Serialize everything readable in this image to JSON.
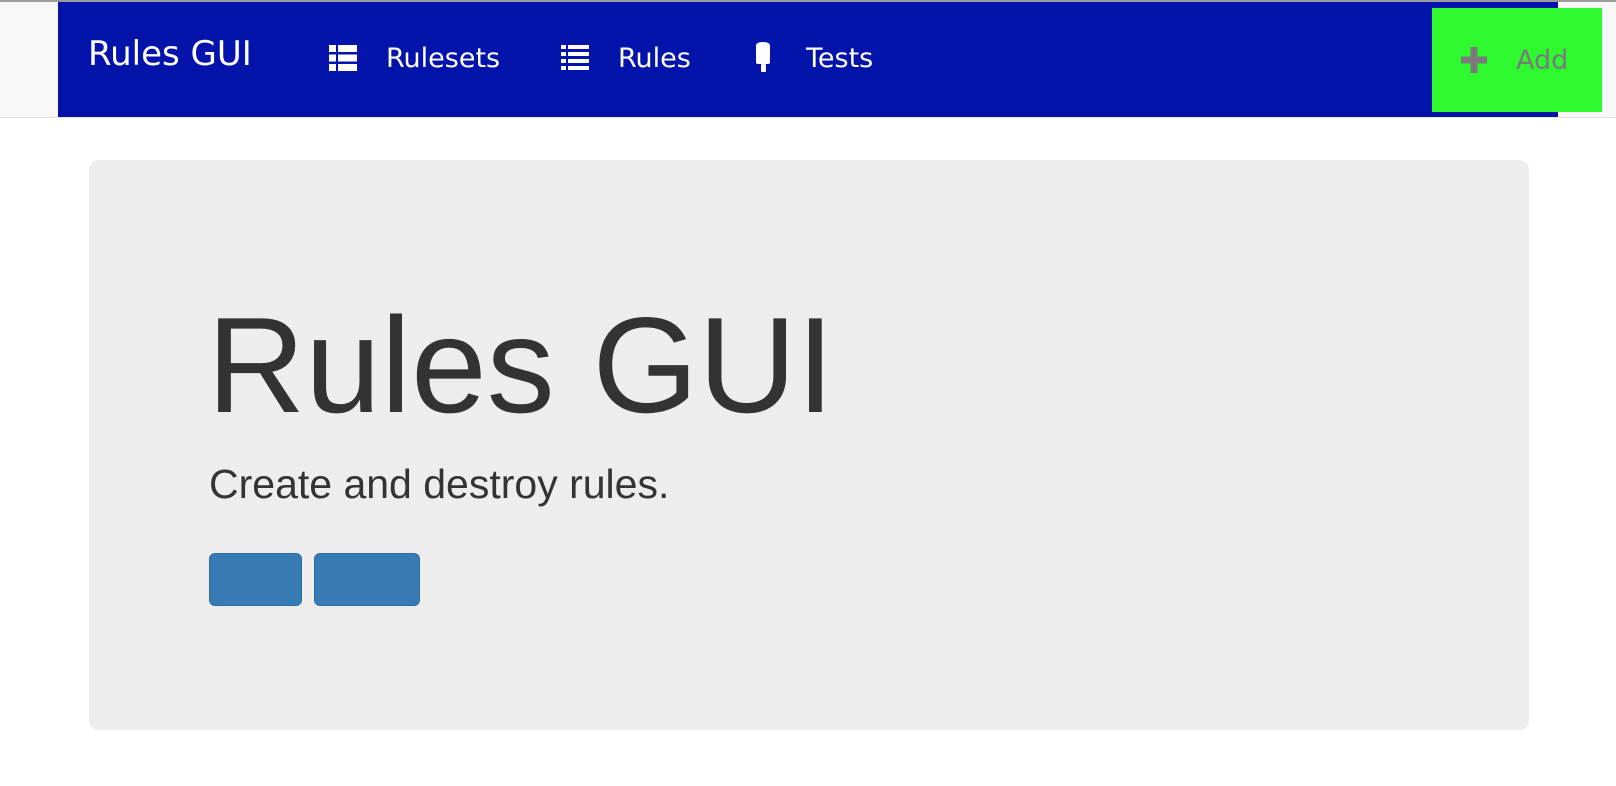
{
  "navbar": {
    "brand": "Rules GUI",
    "background_color": "#0414ab",
    "items": [
      {
        "label": "Rulesets",
        "icon": "list-icon"
      },
      {
        "label": "Rules",
        "icon": "list-icon"
      },
      {
        "label": "Tests",
        "icon": "ice-lolly-icon"
      }
    ],
    "add_button": {
      "label": "Add",
      "icon": "plus-icon",
      "background_color": "#2ef82e"
    }
  },
  "jumbotron": {
    "title": "Rules GUI",
    "lead": "Create and destroy rules.",
    "buttons": [
      {
        "label": "",
        "color": "#377bb5"
      },
      {
        "label": "",
        "color": "#377bb5"
      }
    ]
  }
}
